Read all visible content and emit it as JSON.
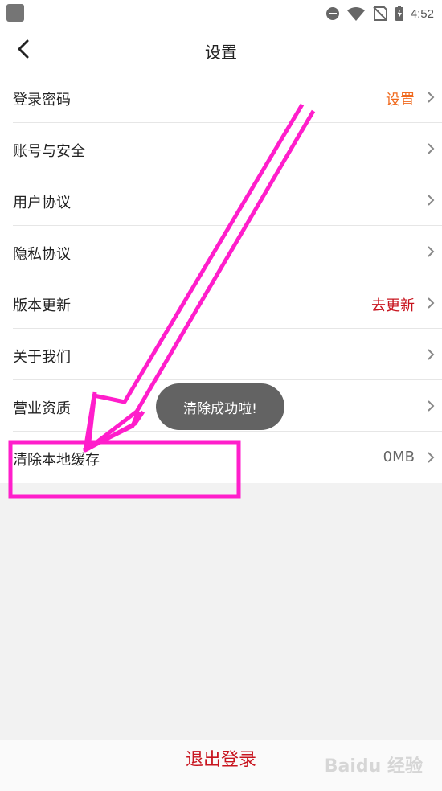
{
  "status_bar": {
    "time": "4:52"
  },
  "nav": {
    "title": "设置"
  },
  "rows": [
    {
      "label": "登录密码",
      "value": "设置",
      "value_color": "#f06a1e"
    },
    {
      "label": "账号与安全",
      "value": ""
    },
    {
      "label": "用户协议",
      "value": ""
    },
    {
      "label": "隐私协议",
      "value": ""
    },
    {
      "label": "版本更新",
      "value": "去更新",
      "value_color": "#c8141e"
    },
    {
      "label": "关于我们",
      "value": ""
    },
    {
      "label": "营业资质",
      "value": ""
    },
    {
      "label": "清除本地缓存",
      "value": "0MB",
      "value_color": "#666666"
    }
  ],
  "toast": {
    "text": "清除成功啦!"
  },
  "footer": {
    "logout_label": "退出登录"
  },
  "watermark": {
    "text": "Baidu 经验"
  },
  "colors": {
    "accent_red": "#c8141e",
    "accent_orange": "#f06a1e",
    "annotation_magenta": "#ff1ecb"
  },
  "icons": {
    "back": "chevron-left-icon",
    "row_chevron": "chevron-right-icon"
  }
}
